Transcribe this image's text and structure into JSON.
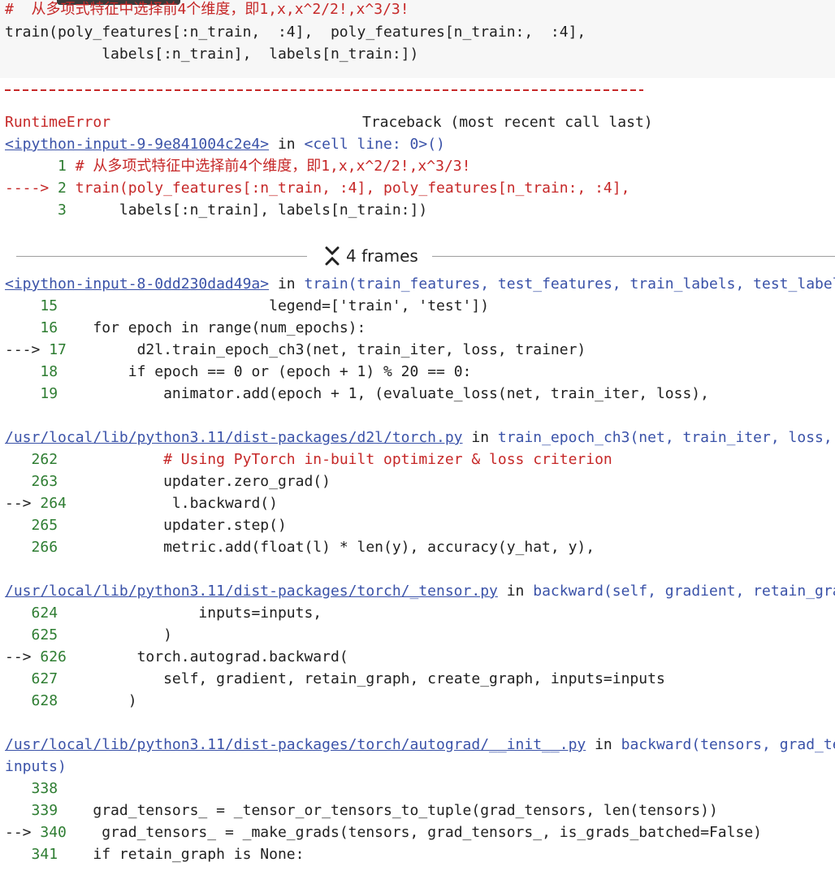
{
  "cell": {
    "lines": [
      "#  从多项式特征中选择前4个维度，即1,x,x^2/2!,x^3/3!",
      "train(poly_features[:n_train,  :4],  poly_features[n_train:,  :4],",
      "           labels[:n_train],  labels[n_train:])"
    ]
  },
  "error": {
    "type": "RuntimeError",
    "traceback_label": "Traceback (most recent call last)",
    "input_ref": "<ipython-input-9-9e841004c2e4>",
    "in_word": "in",
    "cell_line": "<cell line: 0>()",
    "ctx_lines": [
      {
        "prefix": "      ",
        "num": "1",
        "code": " # 从多项式特征中选择前4个维度，即1,x,x^2/2!,x^3/3!",
        "current": false
      },
      {
        "prefix": "----> ",
        "num": "2",
        "code": " train(poly_features[:n_train, :4], poly_features[n_train:, :4],",
        "current": true
      },
      {
        "prefix": "      ",
        "num": "3",
        "code": "      labels[:n_train], labels[n_train:])",
        "current": false
      }
    ]
  },
  "frames_toggle": {
    "label": "4 frames",
    "icon": "collapse-chevrons-icon"
  },
  "frames": [
    {
      "file": "<ipython-input-8-0dd230dad49a>",
      "in_word": "in",
      "func": "train",
      "sig": "(train_features, test_features, train_labels, test_labels,",
      "lines": [
        {
          "prefix": "    ",
          "num": "15",
          "code": "                        legend=['train', 'test'])"
        },
        {
          "prefix": "    ",
          "num": "16",
          "code": "    for epoch in range(num_epochs):"
        },
        {
          "prefix": "---> ",
          "num": "17",
          "code": "        d2l.train_epoch_ch3(net, train_iter, loss, trainer)"
        },
        {
          "prefix": "    ",
          "num": "18",
          "code": "        if epoch == 0 or (epoch + 1) % 20 == 0:"
        },
        {
          "prefix": "    ",
          "num": "19",
          "code": "            animator.add(epoch + 1, (evaluate_loss(net, train_iter, loss),"
        }
      ]
    },
    {
      "file": "/usr/local/lib/python3.11/dist-packages/d2l/torch.py",
      "in_word": "in",
      "func": "train_epoch_ch3",
      "sig": "(net, train_iter, loss, upd",
      "lines": [
        {
          "prefix": "   ",
          "num": "262",
          "code": "            # Using PyTorch in-built optimizer & loss criterion"
        },
        {
          "prefix": "   ",
          "num": "263",
          "code": "            updater.zero_grad()"
        },
        {
          "prefix": "--> ",
          "num": "264",
          "code": "            l.backward()"
        },
        {
          "prefix": "   ",
          "num": "265",
          "code": "            updater.step()"
        },
        {
          "prefix": "   ",
          "num": "266",
          "code": "            metric.add(float(l) * len(y), accuracy(y_hat, y),"
        }
      ]
    },
    {
      "file": "/usr/local/lib/python3.11/dist-packages/torch/_tensor.py",
      "in_word": "in",
      "func": "backward",
      "sig": "(self, gradient, retain_graph,",
      "lines": [
        {
          "prefix": "   ",
          "num": "624",
          "code": "                inputs=inputs,"
        },
        {
          "prefix": "   ",
          "num": "625",
          "code": "            )"
        },
        {
          "prefix": "--> ",
          "num": "626",
          "code": "        torch.autograd.backward("
        },
        {
          "prefix": "   ",
          "num": "627",
          "code": "            self, gradient, retain_graph, create_graph, inputs=inputs"
        },
        {
          "prefix": "   ",
          "num": "628",
          "code": "        )"
        }
      ]
    },
    {
      "file": "/usr/local/lib/python3.11/dist-packages/torch/autograd/__init__.py",
      "in_word": "in",
      "func": "backward",
      "sig": "(tensors, grad_tenso",
      "sig_cont": "inputs)",
      "lines": [
        {
          "prefix": "   ",
          "num": "338",
          "code": ""
        },
        {
          "prefix": "   ",
          "num": "339",
          "code": "    grad_tensors_ = _tensor_or_tensors_to_tuple(grad_tensors, len(tensors))"
        },
        {
          "prefix": "--> ",
          "num": "340",
          "code": "    grad_tensors_ = _make_grads(tensors, grad_tensors_, is_grads_batched=False)"
        },
        {
          "prefix": "   ",
          "num": "341",
          "code": "    if retain_graph is None:"
        }
      ]
    }
  ]
}
